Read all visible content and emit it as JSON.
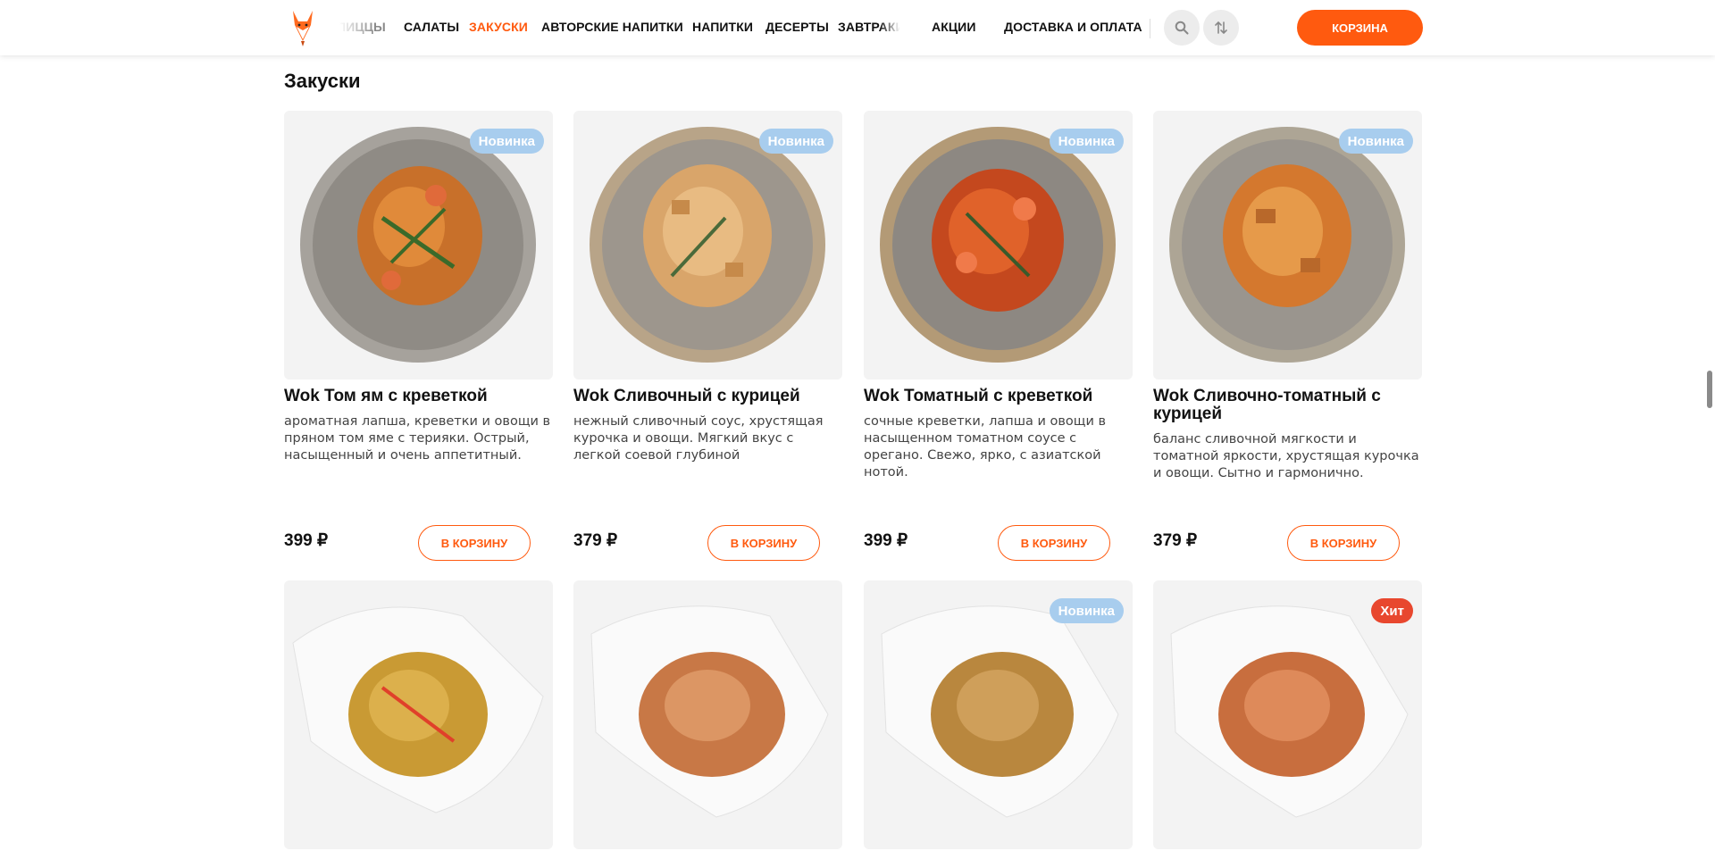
{
  "header": {
    "logo": "fox-logo",
    "nav": [
      {
        "label": "ПИЦЦЫ",
        "active": false
      },
      {
        "label": "САЛАТЫ",
        "active": false
      },
      {
        "label": "ЗАКУСКИ",
        "active": true
      },
      {
        "label": "АВТОРСКИЕ НАПИТКИ",
        "active": false
      },
      {
        "label": "НАПИТКИ",
        "active": false
      },
      {
        "label": "ДЕСЕРТЫ",
        "active": false
      },
      {
        "label": "ЗАВТРАКИ",
        "active": false
      },
      {
        "label": "АКЦИИ",
        "active": false
      },
      {
        "label": "ДОСТАВКА И ОПЛАТА",
        "active": false
      }
    ],
    "search_icon": "search-icon",
    "sort_icon": "sort-arrows-icon",
    "cart_label": "КОРЗИНА"
  },
  "section": {
    "title": "Закуски",
    "add_label": "В КОРЗИНУ",
    "products": [
      {
        "name": "Wok Том ям с креветкой",
        "desc": "ароматная лапша, креветки и овощи в пряном том яме с терияки. Острый, насыщенный и очень аппетитный.",
        "price": "399 ₽",
        "badge": "Новинка",
        "badge_type": "new"
      },
      {
        "name": "Wok Сливочный с курицей",
        "desc": "нежный сливочный соус, хрустящая курочка и овощи. Мягкий вкус с легкой соевой глубиной",
        "price": "379 ₽",
        "badge": "Новинка",
        "badge_type": "new"
      },
      {
        "name": "Wok Томатный с креветкой",
        "desc": "сочные креветки, лапша и овощи в насыщенном томатном соусе с орегано. Свежо, ярко, с азиатской нотой.",
        "price": "399 ₽",
        "badge": "Новинка",
        "badge_type": "new"
      },
      {
        "name": "Wok Сливочно-томатный с курицей",
        "desc": "баланс сливочной мягкости и томатной яркости, хрустящая курочка и овощи. Сытно и гармонично.",
        "price": "379 ₽",
        "badge": "Новинка",
        "badge_type": "new"
      }
    ],
    "products_row2": [
      {
        "badge": ""
      },
      {
        "badge": ""
      },
      {
        "badge": "Новинка",
        "badge_type": "new"
      },
      {
        "badge": "Хит",
        "badge_type": "hit"
      }
    ]
  },
  "colors": {
    "accent": "#ff5a0f",
    "badge_new": "#a8cdee",
    "badge_hit": "#e8472e"
  }
}
